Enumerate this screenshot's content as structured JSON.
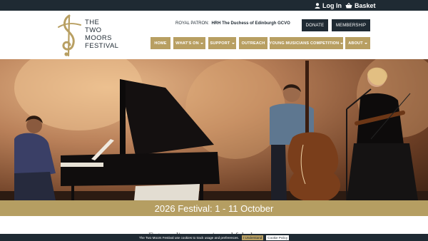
{
  "topbar": {
    "login_label": "Log In",
    "basket_label": "Basket"
  },
  "logo": {
    "line1": "THE",
    "line2": "TWO",
    "line3": "MOORS",
    "line4": "FESTIVAL"
  },
  "patron": {
    "label": "ROYAL PATRON:",
    "name": "HRH The Duchess of Edinburgh GCVO"
  },
  "header_buttons": {
    "donate": "DONATE",
    "membership": "MEMBERSHIP"
  },
  "nav": {
    "items": [
      {
        "label": "HOME"
      },
      {
        "label": "WHAT'S ON"
      },
      {
        "label": "SUPPORT"
      },
      {
        "label": "OUTREACH"
      },
      {
        "label": "YOUNG MUSICIANS COMPETITION"
      },
      {
        "label": "ABOUT"
      }
    ]
  },
  "banner": {
    "text": "2026 Festival: 1 - 11 October"
  },
  "intro": {
    "text": "Extraordinary music and fabulous venues"
  },
  "cookie": {
    "text": "The Two Moors Festival use cookies to track usage and preferences.",
    "accept": "I Understand",
    "policy": "Cookie Policy"
  },
  "colors": {
    "navy": "#1f2a33",
    "gold": "#b89f62"
  },
  "icons": {
    "login": "user-icon",
    "basket": "basket-icon"
  }
}
